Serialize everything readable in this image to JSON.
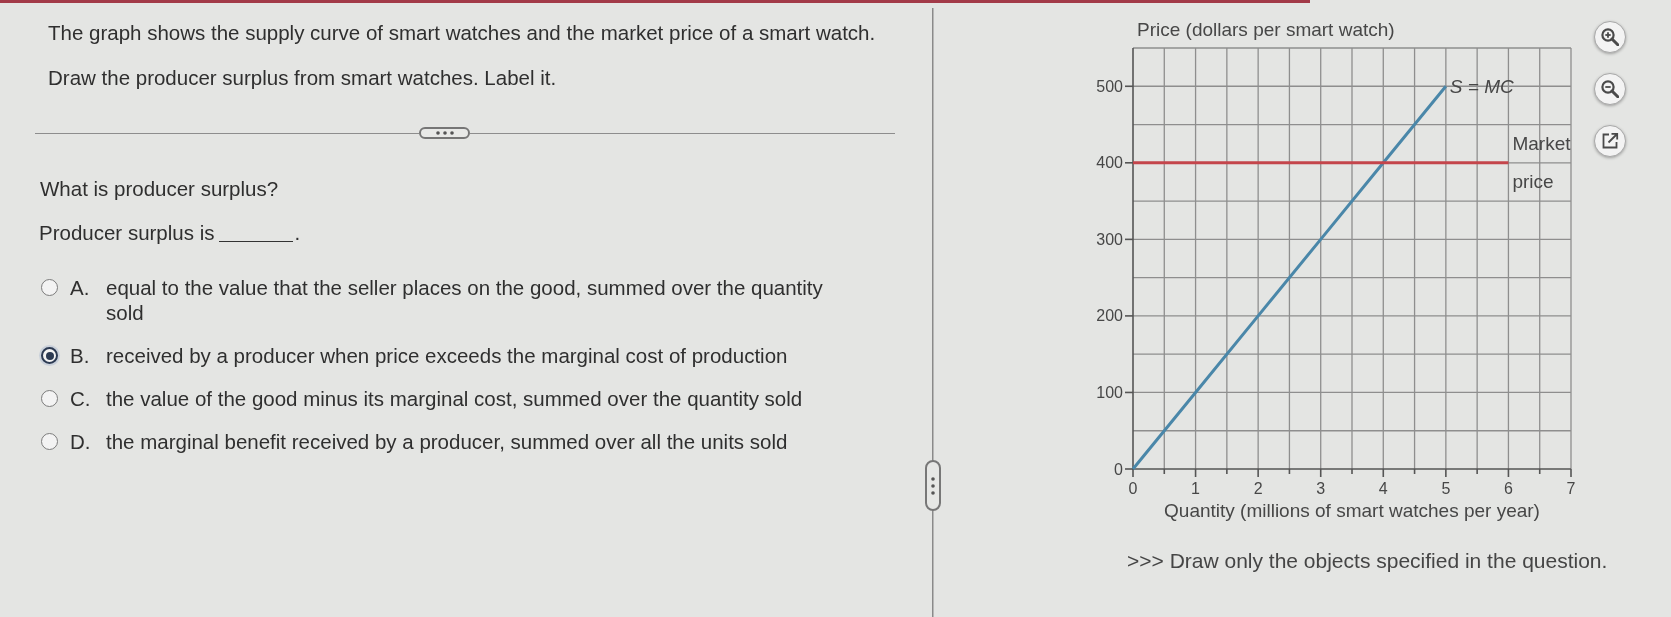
{
  "question": {
    "prompt": [
      "The graph shows the supply curve of smart watches and the market price of a smart watch.",
      "Draw the producer surplus from smart watches. Label it."
    ]
  },
  "sub_question": {
    "text": "What is producer surplus?",
    "stem": "Producer surplus is",
    "stem_end": "."
  },
  "options": [
    {
      "letter": "A.",
      "text": "equal to the value that the seller places on the good, summed over the quantity sold",
      "selected": false
    },
    {
      "letter": "B.",
      "text": "received by a producer when price exceeds the marginal cost of production",
      "selected": true
    },
    {
      "letter": "C.",
      "text": "the value of the good minus its marginal cost, summed over the quantity sold",
      "selected": false
    },
    {
      "letter": "D.",
      "text": "the marginal benefit received by a producer, summed over all the units sold",
      "selected": false
    }
  ],
  "graph": {
    "chart_data": {
      "type": "line",
      "xlabel": "Quantity (millions of smart watches per year)",
      "ylabel": "Price (dollars per smart watch)",
      "x": [
        0,
        1,
        2,
        3,
        4,
        5,
        6
      ],
      "series": [
        {
          "name": "S = MC",
          "color": "#4a87a9",
          "values": [
            0,
            100,
            200,
            300,
            400,
            500,
            null
          ]
        },
        {
          "name": "Market price",
          "color": "#c4454b",
          "values": [
            400,
            400,
            400,
            400,
            400,
            400,
            400
          ]
        }
      ],
      "xlim": [
        0,
        7
      ],
      "ylim": [
        0,
        550
      ],
      "xticks": [
        0,
        1,
        2,
        3,
        4,
        5,
        6,
        7
      ],
      "yticks": [
        0,
        100,
        200,
        300,
        400,
        500
      ],
      "grid": true
    }
  },
  "instruction": ">>> Draw only the objects specified in the question."
}
